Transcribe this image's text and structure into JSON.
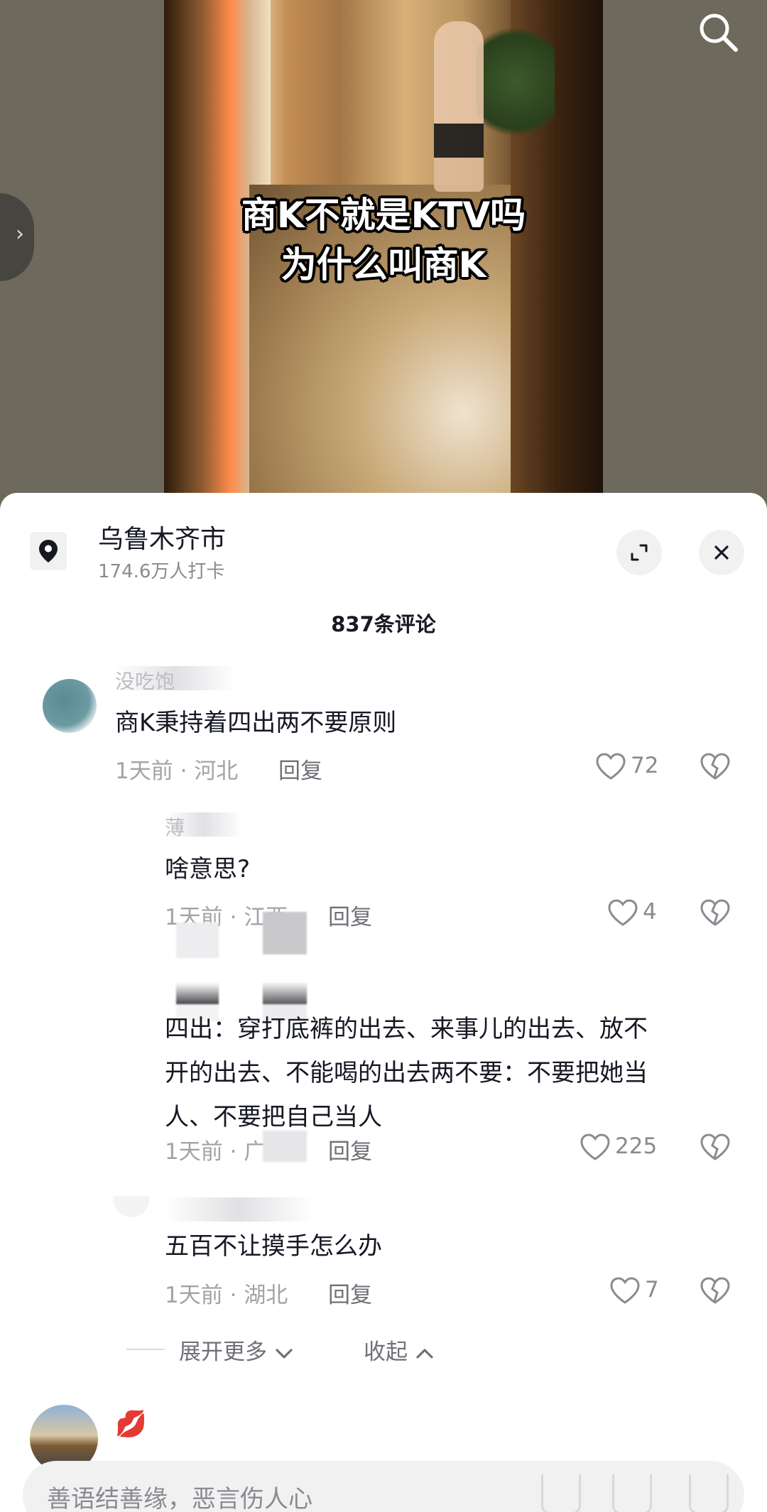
{
  "video": {
    "caption_line1": "商K不就是KTV吗",
    "caption_line2": "为什么叫商K"
  },
  "sheet": {
    "location_name": "乌鲁木齐市",
    "location_checkins": "174.6万人打卡",
    "comment_count": "837条评论"
  },
  "comments": [
    {
      "author": "没吃饱",
      "text": "商K秉持着四出两不要原则",
      "time": "1天前",
      "region": "河北",
      "reply": "回复",
      "likes": "72"
    },
    {
      "author": "薄",
      "text": "啥意思?",
      "time": "1天前",
      "region": "江西",
      "reply": "回复",
      "likes": "4"
    },
    {
      "author": "",
      "text_line1": "四出：穿打底裤的出去、来事儿的出去、放不",
      "text_line2": "开的出去、不能喝的出去两不要：不要把她当",
      "text_line3": "人、不要把自己当人",
      "time": "1天前",
      "region": "广东",
      "reply": "回复",
      "likes": "225"
    },
    {
      "author": "",
      "text": "五百不让摸手怎么办",
      "time": "1天前",
      "region": "湖北",
      "reply": "回复",
      "likes": "7"
    }
  ],
  "thread": {
    "expand_label": "展开更多",
    "collapse_label": "收起"
  },
  "input": {
    "placeholder": "善语结善缘，恶言伤人心"
  },
  "icons": {
    "search": "search-icon",
    "location": "location-pin-icon",
    "expand": "expand-icon",
    "close": "close-icon",
    "like": "heart-icon",
    "dislike": "broken-heart-icon"
  },
  "colors": {
    "text_primary": "#161823",
    "text_secondary": "#8a8b91",
    "sheet_bg": "#ffffff",
    "button_bg": "#f1f1f2"
  }
}
